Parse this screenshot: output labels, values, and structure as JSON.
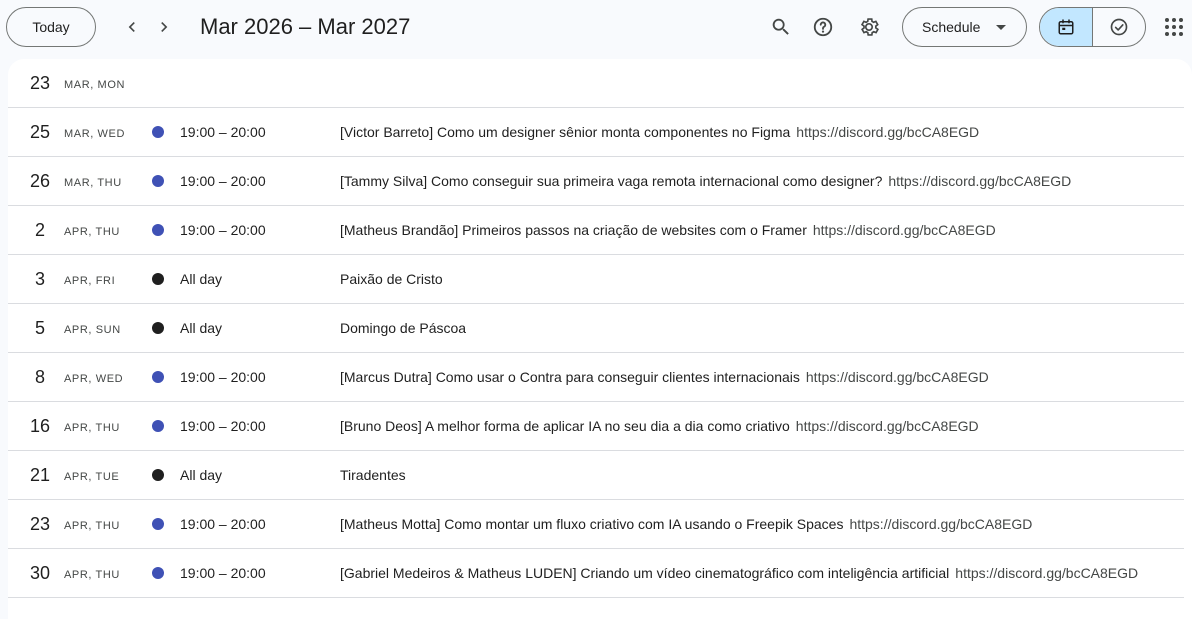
{
  "header": {
    "today_label": "Today",
    "prev_icon": "chevron-left-icon",
    "next_icon": "chevron-right-icon",
    "range_title": "Mar 2026 – Mar 2027",
    "search_icon": "search-icon",
    "help_icon": "help-icon",
    "settings_icon": "gear-icon",
    "view_label": "Schedule",
    "calendar_toggle_icon": "calendar-icon",
    "tasks_toggle_icon": "check-circle-icon",
    "apps_icon": "apps-grid-icon"
  },
  "colors": {
    "event_blue": "#3f51b5",
    "holiday_black": "#1f1f1f",
    "active_toggle": "#c2e7ff"
  },
  "rows": [
    {
      "day": "23",
      "info": "Mar, Mon",
      "color": "",
      "time": "",
      "title": "",
      "location": ""
    },
    {
      "day": "25",
      "info": "Mar, Wed",
      "color": "#3f51b5",
      "time": "19:00 – 20:00",
      "title": "[Victor Barreto] Como um designer sênior monta componentes no Figma",
      "location": "https://discord.gg/bcCA8EGD"
    },
    {
      "day": "26",
      "info": "Mar, Thu",
      "color": "#3f51b5",
      "time": "19:00 – 20:00",
      "title": "[Tammy Silva] Como conseguir sua primeira vaga remota internacional como designer?",
      "location": "https://discord.gg/bcCA8EGD"
    },
    {
      "day": "2",
      "info": "Apr, Thu",
      "color": "#3f51b5",
      "time": "19:00 – 20:00",
      "title": "[Matheus Brandão] Primeiros passos na criação de websites com o Framer",
      "location": "https://discord.gg/bcCA8EGD"
    },
    {
      "day": "3",
      "info": "Apr, Fri",
      "color": "#1f1f1f",
      "time": "All day",
      "title": "Paixão de Cristo",
      "location": ""
    },
    {
      "day": "5",
      "info": "Apr, Sun",
      "color": "#1f1f1f",
      "time": "All day",
      "title": "Domingo de Páscoa",
      "location": ""
    },
    {
      "day": "8",
      "info": "Apr, Wed",
      "color": "#3f51b5",
      "time": "19:00 – 20:00",
      "title": "[Marcus Dutra] Como usar o Contra para conseguir clientes internacionais",
      "location": "https://discord.gg/bcCA8EGD"
    },
    {
      "day": "16",
      "info": "Apr, Thu",
      "color": "#3f51b5",
      "time": "19:00 – 20:00",
      "title": "[Bruno Deos] A melhor forma de aplicar IA no seu dia a dia como criativo",
      "location": "https://discord.gg/bcCA8EGD"
    },
    {
      "day": "21",
      "info": "Apr, Tue",
      "color": "#1f1f1f",
      "time": "All day",
      "title": "Tiradentes",
      "location": ""
    },
    {
      "day": "23",
      "info": "Apr, Thu",
      "color": "#3f51b5",
      "time": "19:00 – 20:00",
      "title": "[Matheus Motta] Como montar um fluxo criativo com IA usando o Freepik Spaces",
      "location": "https://discord.gg/bcCA8EGD"
    },
    {
      "day": "30",
      "info": "Apr, Thu",
      "color": "#3f51b5",
      "time": "19:00 – 20:00",
      "title": "[Gabriel Medeiros & Matheus LUDEN] Criando um vídeo cinematográfico com inteligência artificial",
      "location": "https://discord.gg/bcCA8EGD"
    }
  ]
}
